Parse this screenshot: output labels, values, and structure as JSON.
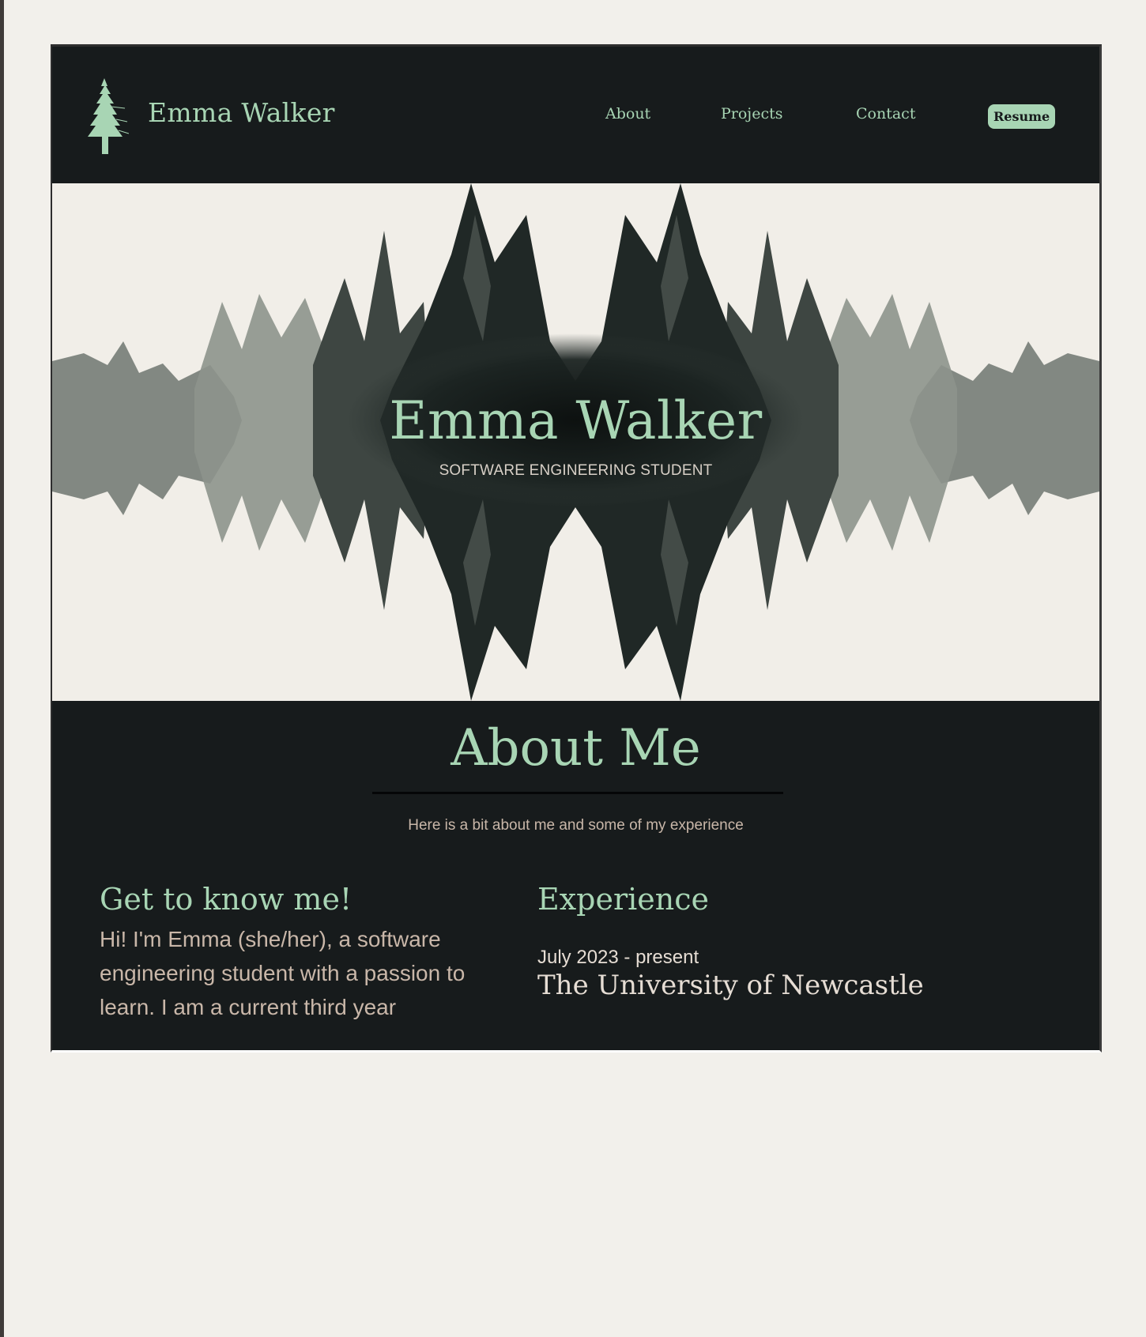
{
  "nav": {
    "brand": "Emma Walker",
    "links": [
      {
        "label": "About"
      },
      {
        "label": "Projects"
      },
      {
        "label": "Contact"
      }
    ],
    "resume_label": "Resume"
  },
  "hero": {
    "title": "Emma Walker",
    "subtitle": "SOFTWARE ENGINEERING STUDENT"
  },
  "about": {
    "title": "About Me",
    "subtitle": "Here is a bit about me and some of my experience",
    "intro_heading": "Get to know me!",
    "intro_text": "Hi! I'm Emma (she/her), a software engineering student with a passion to learn. I am a current third year",
    "experience_heading": "Experience",
    "experience": [
      {
        "date": "July 2023 - present",
        "organization": "The University of Newcastle"
      }
    ]
  },
  "colors": {
    "accent": "#a8d5b4",
    "dark_bg": "#171b1c",
    "page_bg": "#f2f0eb",
    "body_text": "#c9b7a9",
    "light_text": "#e6ddd4"
  },
  "icons": {
    "logo": "pine-tree-icon"
  }
}
